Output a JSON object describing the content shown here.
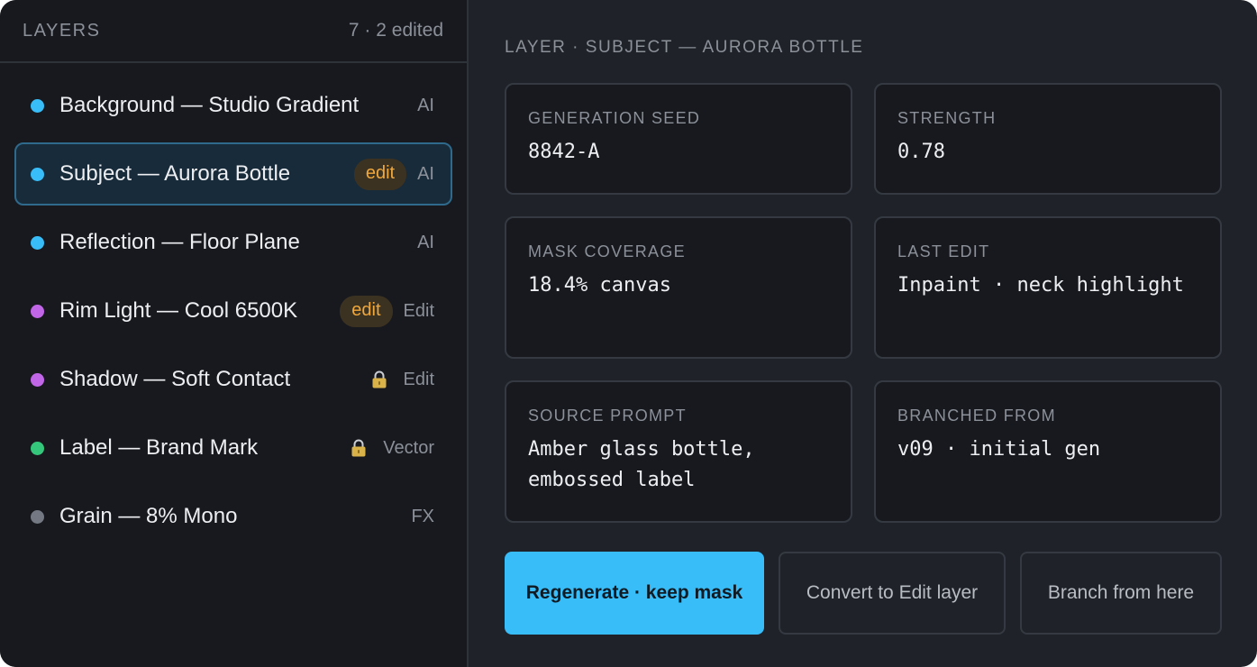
{
  "sidebar": {
    "title": "LAYERS",
    "count": "7 · 2 edited",
    "layers": [
      {
        "name": "Background — Studio Gradient",
        "type": "AI",
        "dot_color": "#38bdf8",
        "badge": "",
        "locked": false,
        "active": false
      },
      {
        "name": "Subject — Aurora Bottle",
        "type": "AI",
        "dot_color": "#38bdf8",
        "badge": "edit",
        "locked": false,
        "active": true
      },
      {
        "name": "Reflection — Floor Plane",
        "type": "AI",
        "dot_color": "#38bdf8",
        "badge": "",
        "locked": false,
        "active": false
      },
      {
        "name": "Rim Light — Cool 6500K",
        "type": "Edit",
        "dot_color": "#c266e8",
        "badge": "edit",
        "locked": false,
        "active": false
      },
      {
        "name": "Shadow — Soft Contact",
        "type": "Edit",
        "dot_color": "#c266e8",
        "badge": "",
        "locked": true,
        "active": false
      },
      {
        "name": "Label — Brand Mark",
        "type": "Vector",
        "dot_color": "#34c77b",
        "badge": "",
        "locked": true,
        "active": false
      },
      {
        "name": "Grain — 8% Mono",
        "type": "FX",
        "dot_color": "#737882",
        "badge": "",
        "locked": false,
        "active": false
      }
    ]
  },
  "main": {
    "title": "LAYER · SUBJECT — AURORA BOTTLE",
    "cards": {
      "seed": {
        "label": "GENERATION SEED",
        "value": "8842-A"
      },
      "strength": {
        "label": "STRENGTH",
        "value": "0.78"
      },
      "mask": {
        "label": "MASK COVERAGE",
        "value": "18.4% canvas"
      },
      "last_edit": {
        "label": "LAST EDIT",
        "value": "Inpaint · neck highlight"
      },
      "prompt": {
        "label": "SOURCE PROMPT",
        "value": "Amber glass bottle, embossed label"
      },
      "branched": {
        "label": "BRANCHED FROM",
        "value": "v09 · initial gen"
      }
    },
    "actions": {
      "regenerate": "Regenerate · keep mask",
      "convert": "Convert to Edit layer",
      "branch": "Branch from here"
    }
  },
  "colors": {
    "accent": "#38bdf8",
    "edit_badge": "#f0a83c",
    "ai_dot": "#38bdf8",
    "edit_dot": "#c266e8",
    "vector_dot": "#34c77b",
    "fx_dot": "#737882"
  },
  "icons": {
    "lock": "lock-icon"
  }
}
